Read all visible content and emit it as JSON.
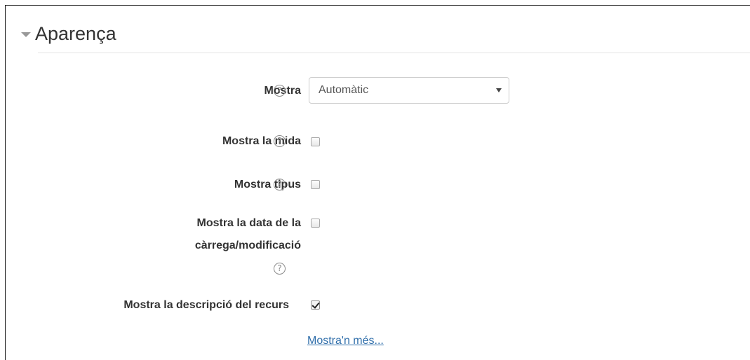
{
  "section": {
    "title": "Aparença"
  },
  "fields": {
    "display": {
      "label": "Mostra",
      "value": "Automàtic"
    },
    "show_size": {
      "label": "Mostra la mida",
      "checked": false
    },
    "show_type": {
      "label": "Mostra tipus",
      "checked": false
    },
    "show_date": {
      "label_line1": "Mostra la data de la",
      "label_line2": "càrrega/modificació",
      "checked": false
    },
    "show_description": {
      "label": "Mostra la descripció del recurs",
      "checked": true
    }
  },
  "help_icon_glyph": "?",
  "show_more_link": "Mostra'n més...",
  "colors": {
    "link": "#2f6eaa",
    "text": "#333333",
    "help_icon": "#8a8a8a"
  }
}
